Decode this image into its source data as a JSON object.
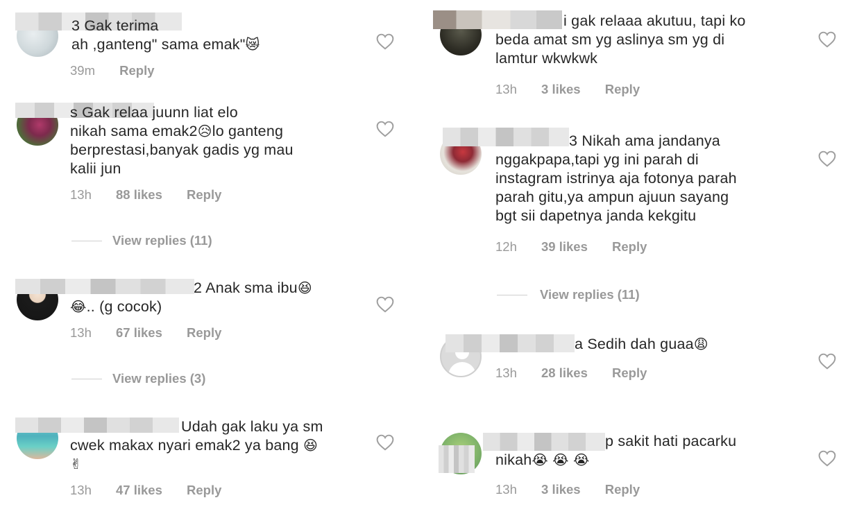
{
  "left": [
    {
      "username_tail": "3",
      "text": "Gak terima ah ,ganteng\" sama emak\"😿",
      "time": "39m",
      "likes": "",
      "reply": "Reply",
      "view_replies": ""
    },
    {
      "username_tail": "s",
      "text": "Gak relaa juunn liat elo nikah sama emak2😥lo ganteng berprestasi,banyak gadis yg mau kalii jun",
      "time": "13h",
      "likes": "88 likes",
      "reply": "Reply",
      "view_replies": "View replies (11)"
    },
    {
      "username_tail": "2",
      "text": "Anak sma ibu😆😂.. (g cocok)",
      "time": "13h",
      "likes": "67 likes",
      "reply": "Reply",
      "view_replies": "View replies (3)"
    },
    {
      "username_tail": "",
      "text": "Udah gak laku ya sm cwek makax nyari emak2 ya bang 😆✌",
      "time": "13h",
      "likes": "47 likes",
      "reply": "Reply",
      "view_replies": ""
    }
  ],
  "right": [
    {
      "username_tail": "i",
      "text": "gak relaaa akutuu, tapi ko beda amat sm yg aslinya sm yg di lamtur wkwkwk",
      "time": "13h",
      "likes": "3 likes",
      "reply": "Reply",
      "view_replies": ""
    },
    {
      "username_tail": "3",
      "text": "Nikah ama jandanya nggakpapa,tapi yg ini parah di instagram istrinya aja fotonya parah parah gitu,ya ampun ajuun sayang bgt sii dapetnya janda kekgitu",
      "time": "12h",
      "likes": "39 likes",
      "reply": "Reply",
      "view_replies": "View replies (11)"
    },
    {
      "username_tail": "a",
      "text": "Sedih dah guaa😩",
      "time": "13h",
      "likes": "28 likes",
      "reply": "Reply",
      "view_replies": ""
    },
    {
      "username_tail": "p",
      "text": "sakit hati pacarku nikah😭😭😭",
      "time": "13h",
      "likes": "3 likes",
      "reply": "Reply",
      "view_replies": ""
    }
  ],
  "icons": {
    "like": "heart-outline-icon"
  }
}
